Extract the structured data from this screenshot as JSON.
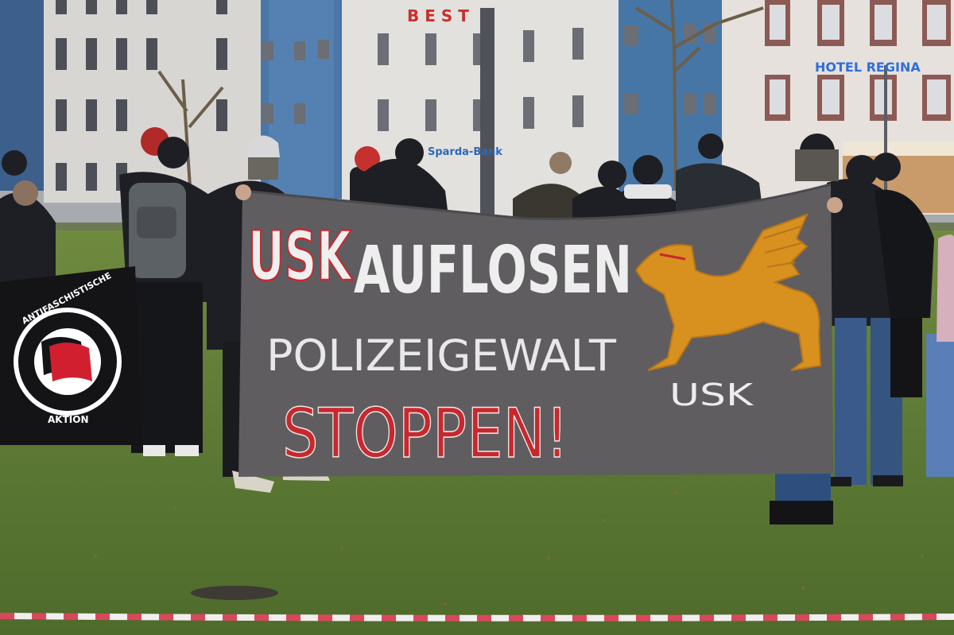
{
  "photo": {
    "banner": {
      "line1_prefix": "USK",
      "line1_rest": "AUFLOSEN",
      "line2": "POLIZEIGEWALT",
      "line3": "STOPPEN!",
      "griffin_caption": "USK"
    },
    "flag": {
      "top_text": "ANTIFASCHISTISCHE",
      "bottom_text": "AKTION"
    },
    "signs": {
      "hotel_sign": "HOTEL  REGINA",
      "top_sign": "B E S T",
      "bank_sign": "Sparda-Bank"
    },
    "colors": {
      "banner_gray": "#5f5d60",
      "banner_red": "#c8282d",
      "griffin_orange": "#d8901f",
      "grass": "#5e7a38",
      "tape_red": "#d9485a"
    }
  }
}
